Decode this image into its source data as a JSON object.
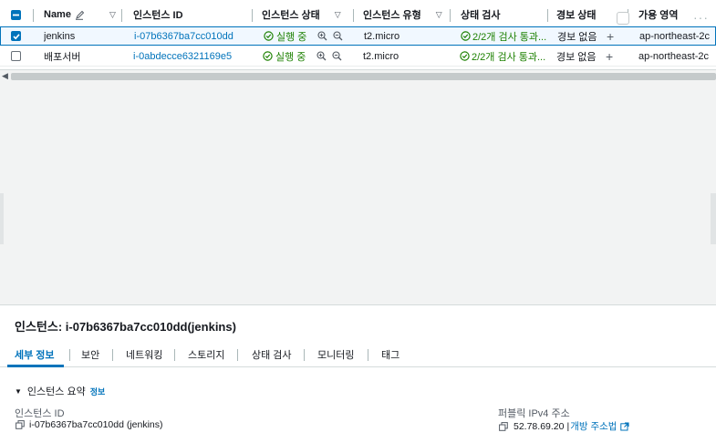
{
  "table": {
    "columns": [
      "Name",
      "인스턴스 ID",
      "인스턴스 상태",
      "인스턴스 유형",
      "상태 검사",
      "경보 상태",
      "가용 영역"
    ],
    "rows": [
      {
        "name": "jenkins",
        "instance_id": "i-07b6367ba7cc010dd",
        "state": "실행 중",
        "type": "t2.micro",
        "status_check": "2/2개 검사 통과...",
        "alarm": "경보 없음",
        "zone": "ap-northeast-2c",
        "selected": true
      },
      {
        "name": "배포서버",
        "instance_id": "i-0abdecce6321169e5",
        "state": "실행 중",
        "type": "t2.micro",
        "status_check": "2/2개 검사 통과...",
        "alarm": "경보 없음",
        "zone": "ap-northeast-2c",
        "selected": false
      }
    ]
  },
  "details": {
    "title": "인스턴스: i-07b6367ba7cc010dd(jenkins)",
    "tabs": [
      "세부 정보",
      "보안",
      "네트워킹",
      "스토리지",
      "상태 검사",
      "모니터링",
      "태그"
    ],
    "summary_header": "인스턴스 요약",
    "summary_info": "정보",
    "instance_id_label": "인스턴스 ID",
    "instance_id_value": "i-07b6367ba7cc010dd (jenkins)",
    "public_ip_label": "퍼블릭 IPv4 주소",
    "public_ip_value": "52.78.69.20",
    "open_address": "개방 주소법"
  },
  "colors": {
    "accent": "#0073bb",
    "success": "#1d8102",
    "muted_bg": "#f2f3f3"
  }
}
